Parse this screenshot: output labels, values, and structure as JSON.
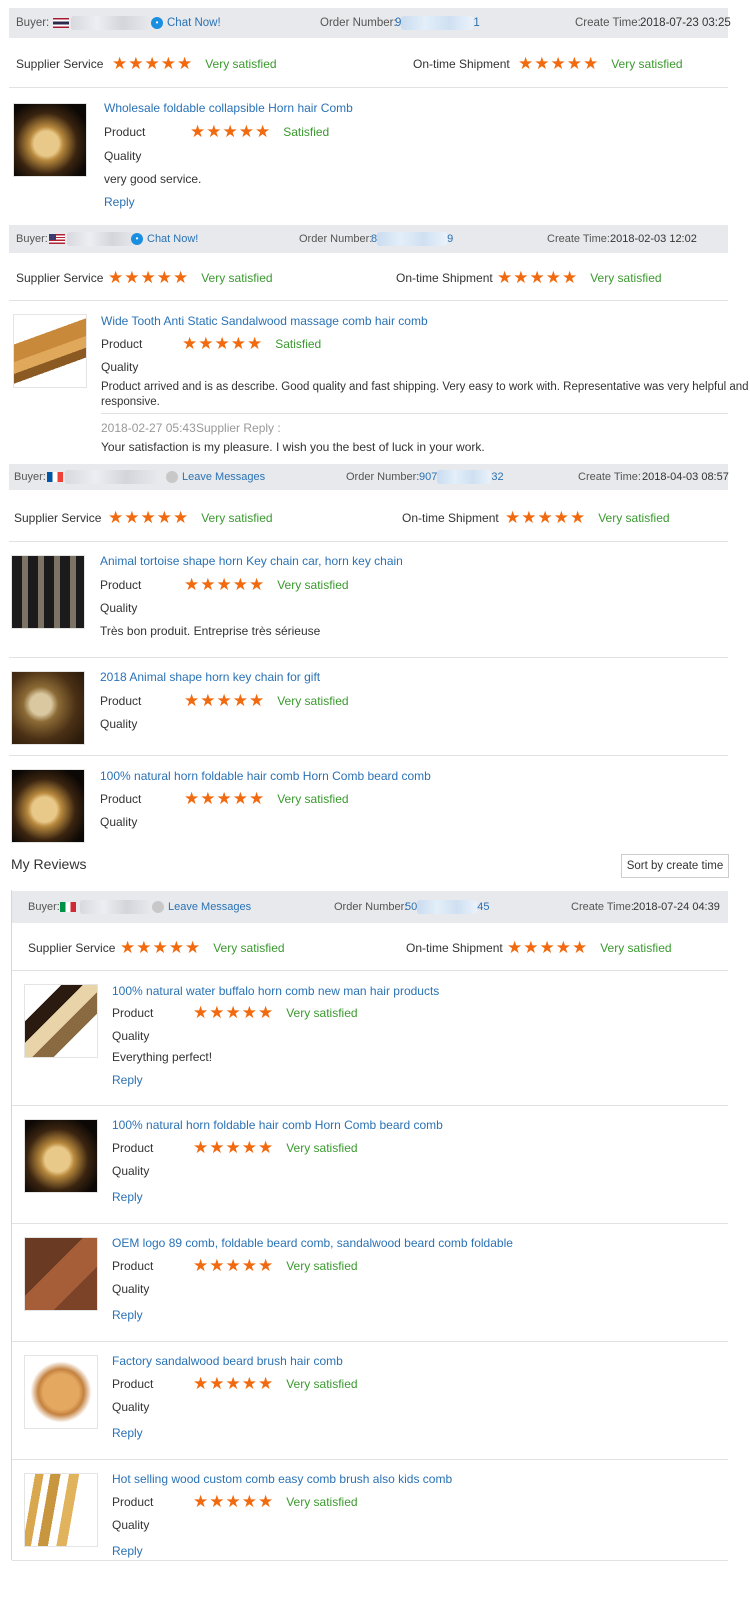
{
  "colors": {
    "star": "#f26a0f",
    "satisfied_text": "#3a9a2e",
    "link": "#2a72b5",
    "header_bg": "#e8e9ec"
  },
  "common": {
    "buyer_label": "Buyer:",
    "chat_now": "Chat Now!",
    "leave_messages": "Leave Messages",
    "order_number_label": "Order Number:",
    "create_time_label": "Create Time:",
    "supplier_service_label": "Supplier Service",
    "ontime_shipment_label": "On-time Shipment",
    "product_label": "Product",
    "quality_label": "Quality",
    "reply_link": "Reply",
    "stars": "★★★★★",
    "very_satisfied": "Very satisfied",
    "satisfied": "Satisfied"
  },
  "orders": [
    {
      "order_prefix": "9",
      "order_suffix": "1",
      "create_time": "2018-07-23 03:25",
      "items": [
        {
          "title": "Wholesale foldable collapsible Horn hair Comb",
          "product_rating": "Satisfied",
          "comment": "very good service."
        }
      ]
    },
    {
      "order_prefix": "8",
      "order_suffix": "9",
      "create_time": "2018-02-03 12:02",
      "items": [
        {
          "title": "Wide Tooth Anti Static Sandalwood massage comb hair comb",
          "product_rating": "Satisfied",
          "comment": "Product arrived and is as describe. Good quality and fast shipping. Very easy to work with. Representative was very helpful and",
          "comment_line2": "responsive.",
          "reply_time": "2018-02-27 05:43",
          "reply_label": "Supplier Reply :",
          "reply_text": "Your satisfaction is my pleasure. I wish you the best of luck in your work."
        }
      ]
    },
    {
      "order_prefix": "907",
      "order_suffix": "32",
      "create_time": "2018-04-03 08:57",
      "items": [
        {
          "title": "Animal tortoise shape horn Key chain car, horn key chain",
          "product_rating": "Very satisfied",
          "comment": "Très bon produit. Entreprise très sérieuse"
        },
        {
          "title": "2018 Animal shape horn key chain for gift",
          "product_rating": "Very satisfied"
        },
        {
          "title": "100% natural horn foldable hair comb Horn Comb beard comb",
          "product_rating": "Very satisfied"
        }
      ]
    }
  ],
  "my_reviews": {
    "heading": "My Reviews",
    "sort_label": "Sort by create time",
    "order": {
      "order_prefix": "50",
      "order_suffix": "45",
      "create_time": "2018-07-24 04:39",
      "items": [
        {
          "title": "100% natural water buffalo horn comb new man hair products",
          "product_rating": "Very satisfied",
          "comment": "Everything perfect!"
        },
        {
          "title": "100% natural horn foldable hair comb Horn Comb beard comb",
          "product_rating": "Very satisfied"
        },
        {
          "title": "OEM logo 89 comb, foldable beard comb, sandalwood beard comb foldable",
          "product_rating": "Very satisfied"
        },
        {
          "title": "Factory sandalwood beard brush hair comb",
          "product_rating": "Very satisfied"
        },
        {
          "title": "Hot selling wood custom comb easy comb brush also kids comb",
          "product_rating": "Very satisfied"
        }
      ]
    }
  }
}
